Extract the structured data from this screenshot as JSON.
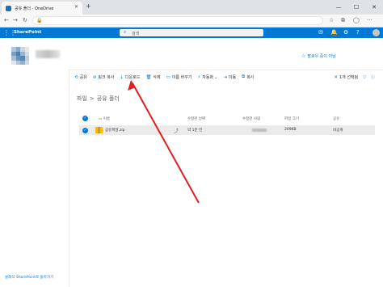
{
  "browser": {
    "tab_title": "공유 폴더 - OneDrive",
    "tab_close": "✕",
    "new_tab": "+",
    "minimize": "—",
    "maximize": "☐",
    "close": "✕",
    "back": "←",
    "forward": "→",
    "refresh": "↻",
    "lock": "🔒",
    "star": "☆",
    "collections": "⧉",
    "profile": "◯",
    "more": "···"
  },
  "suitebar": {
    "waffle": "⋮⋮⋮",
    "brand": "SharePoint",
    "search_placeholder": "검색",
    "search_icon": "⌕",
    "icons": {
      "chat": "✉",
      "notifications": "🔔",
      "settings": "⚙",
      "help": "?"
    },
    "brand_color": "#0078d4"
  },
  "site": {
    "follow_label": "팔로우 중이 아님",
    "follow_star": "☆"
  },
  "commands": [
    {
      "icon": "⟲",
      "label": "공유"
    },
    {
      "icon": "⊘",
      "label": "링크 복사"
    },
    {
      "icon": "↓",
      "label": "다운로드"
    },
    {
      "icon": "🗑",
      "label": "삭제"
    },
    {
      "icon": "▭",
      "label": "이름 바꾸기"
    },
    {
      "icon": "⚡",
      "label": "자동화"
    },
    {
      "icon": "⇥",
      "label": "이동"
    },
    {
      "icon": "⧉",
      "label": "복사"
    }
  ],
  "command_right": {
    "selected": "1개 선택됨",
    "close_icon": "✕",
    "filter_icon": "▽",
    "info_icon": "ⓘ"
  },
  "breadcrumb": {
    "root": "파일",
    "sep": ">",
    "current": "공유 폴더"
  },
  "list": {
    "columns": {
      "name": "이름",
      "modified": "수정된 날짜",
      "modified_by": "수정한 사람",
      "size": "파일 크기",
      "sharing": "공유"
    },
    "rows": [
      {
        "name": "공유파일.zip",
        "modified": "약 1분 전",
        "size": "209KB",
        "sharing": "비공개"
      }
    ]
  },
  "leftnav": {
    "classic_link": "클래식 SharePoint로 돌아가기"
  }
}
